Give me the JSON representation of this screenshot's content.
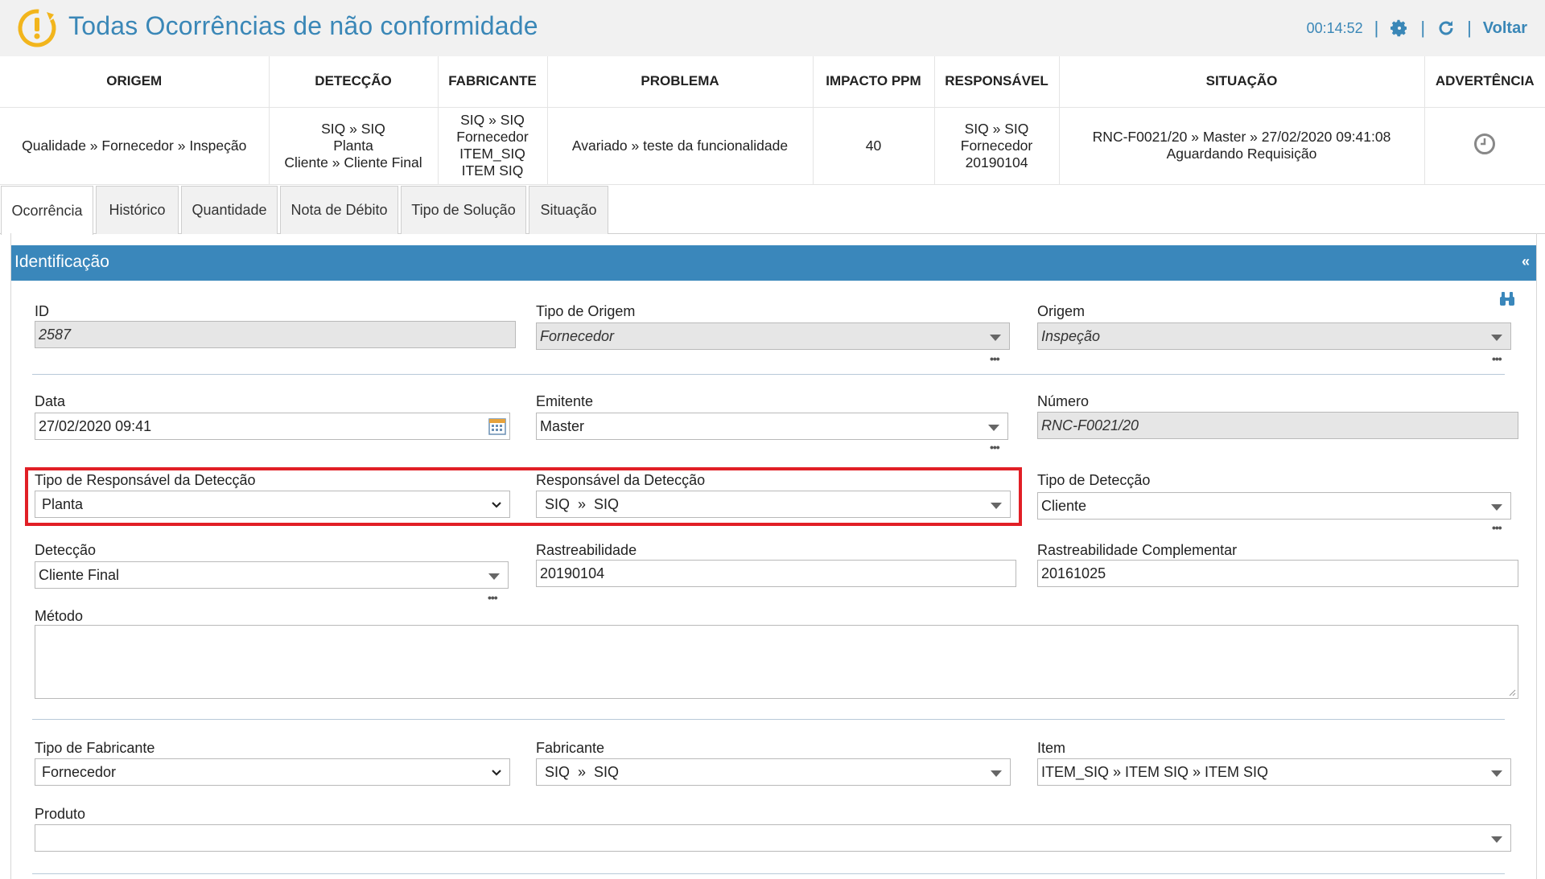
{
  "header": {
    "title": "Todas Ocorrências de não conformidade",
    "timer": "00:14:52",
    "back_label": "Voltar",
    "brand_color": "#3a87b7"
  },
  "summary": {
    "columns": [
      "ORIGEM",
      "DETECÇÃO",
      "FABRICANTE",
      "PROBLEMA",
      "IMPACTO PPM",
      "RESPONSÁVEL",
      "SITUAÇÃO",
      "ADVERTÊNCIA"
    ],
    "row": {
      "origem": "Qualidade » Fornecedor » Inspeção",
      "deteccao": [
        "SIQ » SIQ",
        "Planta",
        "Cliente » Cliente Final"
      ],
      "fabricante": [
        "SIQ » SIQ",
        "Fornecedor",
        "ITEM_SIQ",
        "ITEM SIQ"
      ],
      "problema": "Avariado » teste da funcionalidade",
      "impacto": "40",
      "responsavel": [
        "SIQ » SIQ",
        "Fornecedor",
        "20190104"
      ],
      "situacao": [
        "RNC-F0021/20 » Master » 27/02/2020 09:41:08",
        "Aguardando Requisição"
      ],
      "advertencia_icon": "clock-icon"
    }
  },
  "tabs": [
    "Ocorrência",
    "Histórico",
    "Quantidade",
    "Nota de Débito",
    "Tipo de Solução",
    "Situação"
  ],
  "panel": {
    "title": "Identificação",
    "collapse": "«",
    "accent": "#3a87bb"
  },
  "form": {
    "id": {
      "label": "ID",
      "value": "2587"
    },
    "tipo_origem": {
      "label": "Tipo de Origem",
      "value": "Fornecedor"
    },
    "origem": {
      "label": "Origem",
      "value": "Inspeção"
    },
    "data": {
      "label": "Data",
      "value": "27/02/2020 09:41"
    },
    "emitente": {
      "label": "Emitente",
      "value": "Master"
    },
    "numero": {
      "label": "Número",
      "value": "RNC-F0021/20"
    },
    "tipo_resp": {
      "label": "Tipo de Responsável da Detecção",
      "value": "Planta"
    },
    "resp_deteccao": {
      "label": "Responsável da Detecção",
      "value": "SIQ  »  SIQ"
    },
    "tipo_deteccao": {
      "label": "Tipo de Detecção",
      "value": "Cliente"
    },
    "deteccao": {
      "label": "Detecção",
      "value": "Cliente Final"
    },
    "rastreabilidade": {
      "label": "Rastreabilidade",
      "value": "20190104"
    },
    "rastreabilidade_comp": {
      "label": "Rastreabilidade Complementar",
      "value": "20161025"
    },
    "metodo": {
      "label": "Método",
      "value": ""
    },
    "tipo_fabricante": {
      "label": "Tipo de Fabricante",
      "value": "Fornecedor"
    },
    "fabricante": {
      "label": "Fabricante",
      "value": "SIQ  »  SIQ"
    },
    "item": {
      "label": "Item",
      "value": "ITEM_SIQ » ITEM SIQ » ITEM SIQ"
    },
    "produto": {
      "label": "Produto",
      "value": ""
    },
    "more": "•••"
  }
}
